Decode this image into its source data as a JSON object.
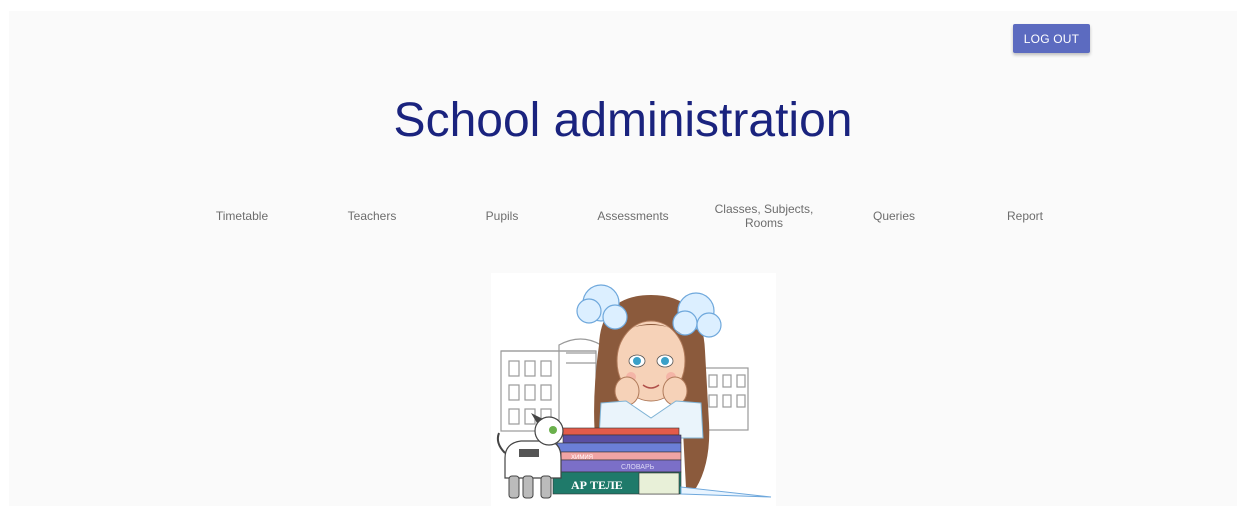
{
  "header": {
    "logout_label": "LOG OUT",
    "title": "School administration"
  },
  "nav": {
    "items": [
      {
        "label": "Timetable"
      },
      {
        "label": "Teachers"
      },
      {
        "label": "Pupils"
      },
      {
        "label": "Assessments"
      },
      {
        "label": "Classes, Subjects, Rooms"
      },
      {
        "label": "Queries"
      },
      {
        "label": "Report"
      }
    ]
  },
  "illustration": {
    "book_spine_1": "ХИМИЯ",
    "book_spine_2": "СЛОВАРЬ",
    "book_spine_3": "АР ТЕЛЕ"
  },
  "colors": {
    "title": "#1a237e",
    "button": "#5c6bc0",
    "nav_text": "#6d6d6d",
    "background": "#fafafa"
  }
}
